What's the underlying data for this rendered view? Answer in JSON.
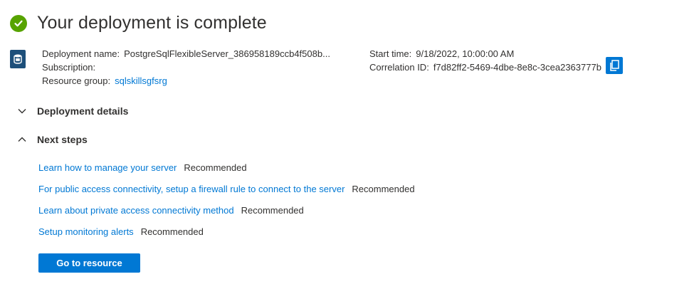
{
  "header": {
    "title": "Your deployment is complete",
    "status_icon": "check-circle-icon",
    "status_color": "#57a300"
  },
  "details": {
    "resource_icon": "postgres-server-icon",
    "deployment_name_label": "Deployment name:",
    "deployment_name_value": "PostgreSqlFlexibleServer_386958189ccb4f508b...",
    "subscription_label": "Subscription:",
    "subscription_value": "",
    "resource_group_label": "Resource group:",
    "resource_group_value": "sqlskillsgfsrg",
    "start_time_label": "Start time:",
    "start_time_value": "9/18/2022, 10:00:00 AM",
    "correlation_id_label": "Correlation ID:",
    "correlation_id_value": "f7d82ff2-5469-4dbe-8e8c-3cea2363777b",
    "copy_icon": "copy-icon"
  },
  "sections": {
    "deployment_details": {
      "label": "Deployment details",
      "state": "collapsed"
    },
    "next_steps": {
      "label": "Next steps",
      "state": "expanded"
    }
  },
  "next_steps": [
    {
      "link": "Learn how to manage your server",
      "tag": "Recommended"
    },
    {
      "link": "For public access connectivity, setup a firewall rule to connect to the server",
      "tag": "Recommended"
    },
    {
      "link": "Learn about private access connectivity method",
      "tag": "Recommended"
    },
    {
      "link": "Setup monitoring alerts",
      "tag": "Recommended"
    }
  ],
  "actions": {
    "go_to_resource_label": "Go to resource"
  },
  "colors": {
    "accent": "#0078d4",
    "text": "#323130",
    "resource_icon_bg": "#1d4f7a"
  }
}
